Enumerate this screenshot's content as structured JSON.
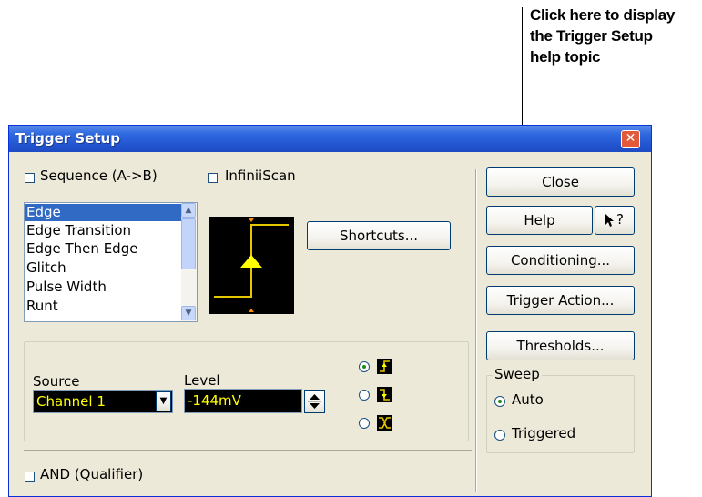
{
  "callout": {
    "line1": "Click here to display",
    "line2": "the Trigger Setup",
    "line3": "help topic"
  },
  "dialog": {
    "title": "Trigger Setup",
    "close_glyph": "✕",
    "sequence_label": "Sequence (A->B)",
    "infiniiscan_label": "InfiniiScan",
    "trigger_types": [
      "Edge",
      "Edge Transition",
      "Edge Then Edge",
      "Glitch",
      "Pulse Width",
      "Runt"
    ],
    "selected_type": "Edge",
    "shortcuts_label": "Shortcuts...",
    "source_label": "Source",
    "source_value": "Channel 1",
    "level_label": "Level",
    "level_value": "-144mV",
    "and_qualifier_label": "AND (Qualifier)",
    "buttons": {
      "close": "Close",
      "help": "Help",
      "whats_this": "?",
      "conditioning": "Conditioning...",
      "trigger_action": "Trigger Action...",
      "thresholds": "Thresholds..."
    },
    "sweep": {
      "label": "Sweep",
      "auto": "Auto",
      "triggered": "Triggered",
      "selected": "Auto"
    },
    "slope_selected": "rising",
    "colors": {
      "accent": "#ffff00",
      "titlebar": "#2254d0",
      "selection": "#316ac5"
    }
  }
}
